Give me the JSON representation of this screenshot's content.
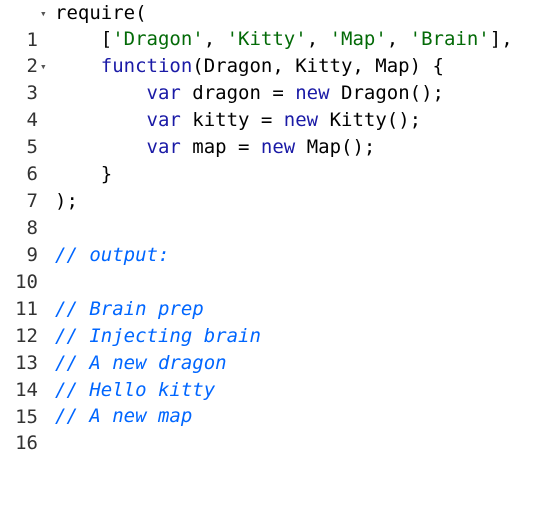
{
  "colors": {
    "keyword": "#1a1aa6",
    "string": "#036a07",
    "comment": "#0066ff",
    "text": "#000000",
    "gutter": "#333333"
  },
  "fold_icon": "triangle-down-icon",
  "lines": [
    {
      "num": "1",
      "fold": "▾",
      "tokens": {
        "t1": "require("
      }
    },
    {
      "num": "2",
      "tokens": {
        "t1": "    [",
        "t2": "'Dragon'",
        "t3": ", ",
        "t4": "'Kitty'",
        "t5": ", ",
        "t6": "'Map'",
        "t7": ", ",
        "t8": "'Brain'",
        "t9": "],"
      }
    },
    {
      "num": "3",
      "fold": "▾",
      "tokens": {
        "t1": "    ",
        "t2": "function",
        "t3": "(Dragon, Kitty, Map) {"
      }
    },
    {
      "num": "4",
      "tokens": {
        "t1": "        ",
        "t2": "var",
        "t3": " dragon = ",
        "t4": "new",
        "t5": " Dragon();"
      }
    },
    {
      "num": "5",
      "tokens": {
        "t1": "        ",
        "t2": "var",
        "t3": " kitty = ",
        "t4": "new",
        "t5": " Kitty();"
      }
    },
    {
      "num": "6",
      "tokens": {
        "t1": "        ",
        "t2": "var",
        "t3": " map = ",
        "t4": "new",
        "t5": " Map();"
      }
    },
    {
      "num": "7",
      "tokens": {
        "t1": "    }"
      }
    },
    {
      "num": "8",
      "tokens": {
        "t1": ");"
      }
    },
    {
      "num": "9",
      "tokens": {}
    },
    {
      "num": "10",
      "tokens": {
        "c": "// output:"
      }
    },
    {
      "num": "11",
      "tokens": {}
    },
    {
      "num": "12",
      "tokens": {
        "c": "// Brain prep"
      }
    },
    {
      "num": "13",
      "tokens": {
        "c": "// Injecting brain"
      }
    },
    {
      "num": "14",
      "tokens": {
        "c": "// A new dragon"
      }
    },
    {
      "num": "15",
      "tokens": {
        "c": "// Hello kitty"
      }
    },
    {
      "num": "16",
      "tokens": {
        "c": "// A new map"
      }
    }
  ]
}
